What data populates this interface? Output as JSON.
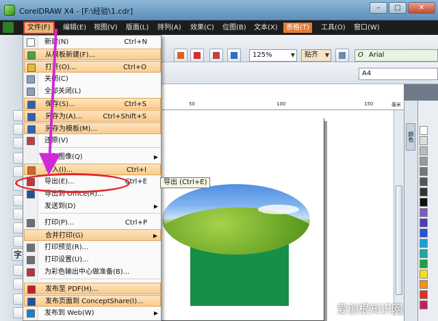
{
  "window": {
    "title": "CorelDRAW X4 - [F:\\经验\\1.cdr]",
    "buttons": [
      "–",
      "□",
      "✕"
    ]
  },
  "menubar": [
    "文件(F)",
    "编辑(E)",
    "视图(V)",
    "版面(L)",
    "排列(A)",
    "效果(C)",
    "位图(B)",
    "文本(X)",
    "表格(T)",
    "工具(O)",
    "窗口(W)"
  ],
  "toolbar": {
    "zoom": "125%",
    "snap": "贴齐",
    "font": "Arial",
    "page_size": "A4"
  },
  "ruler": {
    "labels": [
      "50",
      "100",
      "150",
      "毫米"
    ]
  },
  "docker": {
    "tab": "颜色"
  },
  "file_menu": [
    {
      "label": "新建(N)",
      "shortcut": "Ctrl+N",
      "icon": "new-icon",
      "hl": false,
      "submenu": false
    },
    {
      "label": "从模板新建(F)...",
      "shortcut": "",
      "icon": "template-icon",
      "hl": true,
      "submenu": false
    },
    {
      "label": "打开(O)...",
      "shortcut": "Ctrl+O",
      "icon": "open-icon",
      "hl": true,
      "submenu": false
    },
    {
      "label": "关闭(C)",
      "shortcut": "",
      "icon": "close-doc-icon",
      "hl": false,
      "submenu": false
    },
    {
      "label": "全部关闭(L)",
      "shortcut": "",
      "icon": "close-all-icon",
      "hl": false,
      "submenu": false
    },
    {
      "label": "保存(S)...",
      "shortcut": "Ctrl+S",
      "icon": "save-icon",
      "hl": true,
      "submenu": false
    },
    {
      "label": "另存为(A)...",
      "shortcut": "Ctrl+Shift+S",
      "icon": "save-as-icon",
      "hl": true,
      "submenu": false
    },
    {
      "label": "另存为模板(M)...",
      "shortcut": "",
      "icon": "save-template-icon",
      "hl": true,
      "submenu": false
    },
    {
      "label": "还原(V)",
      "shortcut": "",
      "icon": "revert-icon",
      "hl": false,
      "submenu": false
    },
    {
      "label": "获取图像(Q)",
      "shortcut": "",
      "icon": "",
      "hl": false,
      "submenu": true
    },
    {
      "label": "导入(I)...",
      "shortcut": "Ctrl+I",
      "icon": "import-icon",
      "hl": true,
      "submenu": false
    },
    {
      "label": "导出(E)...",
      "shortcut": "Ctrl+E",
      "icon": "export-icon",
      "hl": false,
      "submenu": false
    },
    {
      "label": "导出到 Office(R)...",
      "shortcut": "",
      "icon": "export-office-icon",
      "hl": false,
      "submenu": false
    },
    {
      "label": "发送到(D)",
      "shortcut": "",
      "icon": "",
      "hl": false,
      "submenu": true
    },
    {
      "label": "打印(P)...",
      "shortcut": "Ctrl+P",
      "icon": "print-icon",
      "hl": false,
      "submenu": false
    },
    {
      "label": "合并打印(G)",
      "shortcut": "",
      "icon": "",
      "hl": true,
      "submenu": true
    },
    {
      "label": "打印预览(R)...",
      "shortcut": "",
      "icon": "print-preview-icon",
      "hl": false,
      "submenu": false
    },
    {
      "label": "打印设置(U)...",
      "shortcut": "",
      "icon": "print-setup-icon",
      "hl": false,
      "submenu": false
    },
    {
      "label": "为彩色输出中心做准备(B)...",
      "shortcut": "",
      "icon": "color-output-icon",
      "hl": false,
      "submenu": false
    },
    {
      "label": "发布至 PDF(H)...",
      "shortcut": "",
      "icon": "pdf-icon",
      "hl": true,
      "submenu": false
    },
    {
      "label": "发布页面到 ConceptShare(I)...",
      "shortcut": "",
      "icon": "conceptshare-icon",
      "hl": true,
      "submenu": false
    },
    {
      "label": "发布到 Web(W)",
      "shortcut": "",
      "icon": "web-icon",
      "hl": false,
      "submenu": true
    }
  ],
  "tooltip": "导出 (Ctrl+E)",
  "watermark": "爱创根知识网",
  "palette_colors": [
    "#ffffff",
    "#dddddd",
    "#bbbbbb",
    "#999999",
    "#777777",
    "#555555",
    "#333333",
    "#111111",
    "#7a5ac8",
    "#4b3cc0",
    "#2255cc",
    "#1aa0d8",
    "#20a8a0",
    "#20a040",
    "#f0e020",
    "#f09020",
    "#e03020",
    "#c02060"
  ]
}
